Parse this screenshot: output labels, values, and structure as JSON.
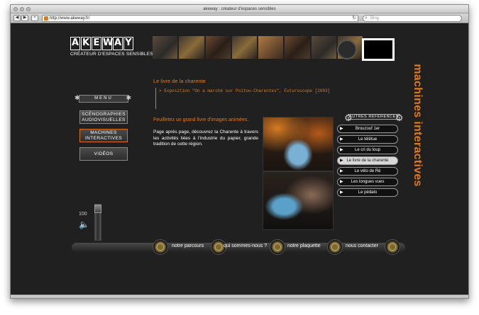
{
  "window": {
    "title": "akeway : créateur d'espaces sensibles"
  },
  "browser": {
    "url": "http://www.akeway.fr/",
    "search_placeholder": "Bing"
  },
  "logo": {
    "letters": [
      "A",
      "K",
      "E",
      "W",
      "A",
      "Y"
    ],
    "tagline": "CRÉATEUR D'ESPACES SENSIBLES"
  },
  "menu": {
    "header": "MENU",
    "items": [
      {
        "label": "SCÉNOGRAPHIES AUDIOVISUELLES",
        "active": false
      },
      {
        "label": "MACHINES INTERACTIVES",
        "active": true
      },
      {
        "label": "VIDÉOS",
        "active": false
      }
    ]
  },
  "volume": {
    "label": "100",
    "level": 1.0
  },
  "content": {
    "title": "Le livre de la charente",
    "expo": "> Exposition \"On a marché sur Poitou-Charentes\", Futuroscope [2003]",
    "subtitle": "Feuilletez un grand livre d'images animées.",
    "description": "Page après page, découvrez la Charente à travers les activités liées à l'industrie du papier, grande tradition de cette région."
  },
  "references": {
    "header": "AUTRES RÉFÉRENCES",
    "items": [
      {
        "label": "Brouzouf 1er",
        "active": false
      },
      {
        "label": "Le télétue",
        "active": false
      },
      {
        "label": "Le cri du loup",
        "active": false
      },
      {
        "label": "Le livre de la charente",
        "active": true
      },
      {
        "label": "Le vélo de Ré",
        "active": false
      },
      {
        "label": "Les longues vues",
        "active": false
      },
      {
        "label": "Le pédalo",
        "active": false
      }
    ]
  },
  "section_title": "machines interactives",
  "bottom_nav": [
    {
      "label": "notre parcours"
    },
    {
      "label": "qui sommes-nous ?"
    },
    {
      "label": "notre plaquette"
    },
    {
      "label": "nous contacter"
    }
  ],
  "colors": {
    "accent": "#e07a18",
    "background": "#202020",
    "text": "#ffffff"
  }
}
